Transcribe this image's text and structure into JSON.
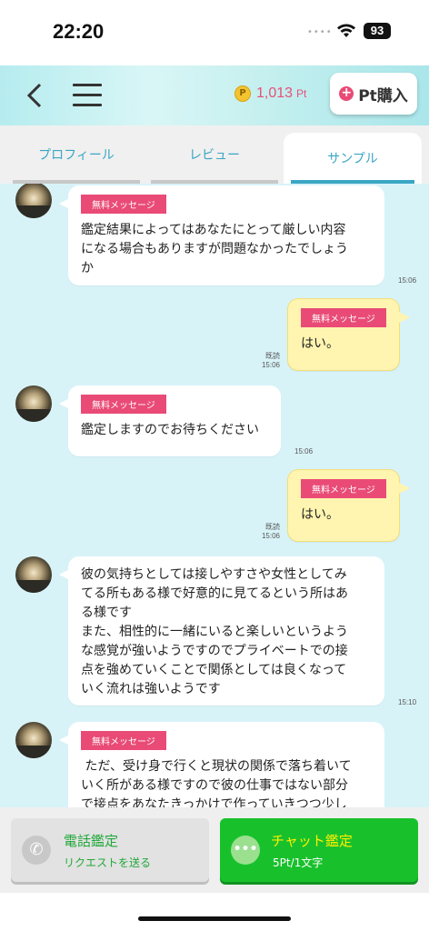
{
  "status_bar": {
    "time": "22:20",
    "battery": "93"
  },
  "header": {
    "points_value": "1,013",
    "points_unit": "Pt",
    "coin_label": "P",
    "buy_label": "Pt購入"
  },
  "tabs": [
    {
      "label": "プロフィール"
    },
    {
      "label": "レビュー"
    },
    {
      "label": "サンプル"
    }
  ],
  "messages": [
    {
      "from": "advisor",
      "tag": "無料メッセージ",
      "text": "鑑定結果によってはあなたにとって厳しい内容\nになる場合もありますが問題なかったでしょう\nか",
      "time": "15:06"
    },
    {
      "from": "user",
      "tag": "無料メッセージ",
      "text": "はい。",
      "read": "既読",
      "time": "15:06"
    },
    {
      "from": "advisor",
      "tag": "無料メッセージ",
      "text": "鑑定しますのでお待ちください",
      "time": "15:06"
    },
    {
      "from": "user",
      "tag": "無料メッセージ",
      "text": "はい。",
      "read": "既読",
      "time": "15:06"
    },
    {
      "from": "advisor",
      "tag": "",
      "text": "彼の気持ちとしては接しやすさや女性としてみ\nてる所もある様で好意的に見てるという所はあ\nる様です\nまた、相性的に一緒にいると楽しいというよう\nな感覚が強いようですのでプライベートでの接\n点を強めていくことで関係としては良くなって\nいく流れは強いようです",
      "time": "15:10"
    },
    {
      "from": "advisor",
      "tag": "無料メッセージ",
      "text": " ただ、受け身で行くと現状の関係で落ち着いて\nいく所がある様ですので彼の仕事ではない部分\nで接点をあなたきっかけで作っていきつつ少し",
      "time": ""
    }
  ],
  "bottom": {
    "call": {
      "title": "電話鑑定",
      "sub": "リクエストを送る"
    },
    "chat": {
      "title": "チャット鑑定",
      "sub": "5Pt/1文字"
    }
  }
}
